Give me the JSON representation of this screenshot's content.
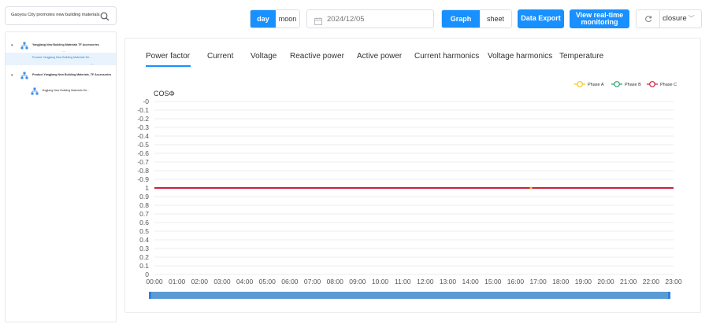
{
  "sidebar": {
    "search_text": "Gaoyou City promotes new building materials",
    "tree": [
      {
        "label": "Yangjiang New Building Materials TF Accessories",
        "kind": "group"
      },
      {
        "label": "Product Yangjiang New Building Materials Dri...",
        "kind": "leaf",
        "selected": true
      },
      {
        "label": "Product Yangjiang New Building Materials_TF Accessories",
        "kind": "group"
      },
      {
        "label": "Jingjiang New Building Materials Dri...",
        "kind": "leaf",
        "selected": false
      }
    ]
  },
  "toolbar": {
    "period_options": [
      "day",
      "moon"
    ],
    "period_selected": "day",
    "date_value": "2024/12/05",
    "view_options": [
      "Graph",
      "sheet"
    ],
    "view_selected": "Graph",
    "export_label": "Data Export",
    "realtime_label_line1": "View real-time",
    "realtime_label_line2": "monitoring",
    "closure_label": "closure"
  },
  "tabs": [
    "Power factor",
    "Current",
    "Voltage",
    "Reactive power",
    "Active power",
    "Current harmonics",
    "Voltage harmonics",
    "Temperature"
  ],
  "active_tab": "Power factor",
  "colors": {
    "accent": "#1890ff",
    "phase_a": "#f5c518",
    "phase_b": "#2ca26b",
    "phase_c": "#cc1f3c",
    "grid": "#e6e6e6",
    "scrollbar": "#5b9bd5"
  },
  "chart_data": {
    "type": "line",
    "ylabel": "COSΦ",
    "y_ticks": [
      "-0",
      "-0.1",
      "-0.2",
      "-0.3",
      "-0.4",
      "-0.5",
      "-0.6",
      "-0.7",
      "-0.8",
      "-0.9",
      "1",
      "0.9",
      "0.8",
      "0.7",
      "0.6",
      "0.5",
      "0.4",
      "0.3",
      "0.2",
      "0.1",
      "0"
    ],
    "x_ticks": [
      "00:00",
      "01:00",
      "02:00",
      "03:00",
      "04:00",
      "05:00",
      "06:00",
      "07:00",
      "08:00",
      "09:00",
      "10:00",
      "11:00",
      "12:00",
      "13:00",
      "14:00",
      "15:00",
      "16:00",
      "17:00",
      "18:00",
      "19:00",
      "20:00",
      "21:00",
      "22:00",
      "23:00"
    ],
    "series": [
      {
        "name": "Phase A",
        "color": "#f5c518",
        "value": 1
      },
      {
        "name": "Phase B",
        "color": "#2ca26b",
        "value": 1
      },
      {
        "name": "Phase C",
        "color": "#cc1f3c",
        "value": 1
      }
    ],
    "legend_position": "top-right",
    "grid": true
  }
}
